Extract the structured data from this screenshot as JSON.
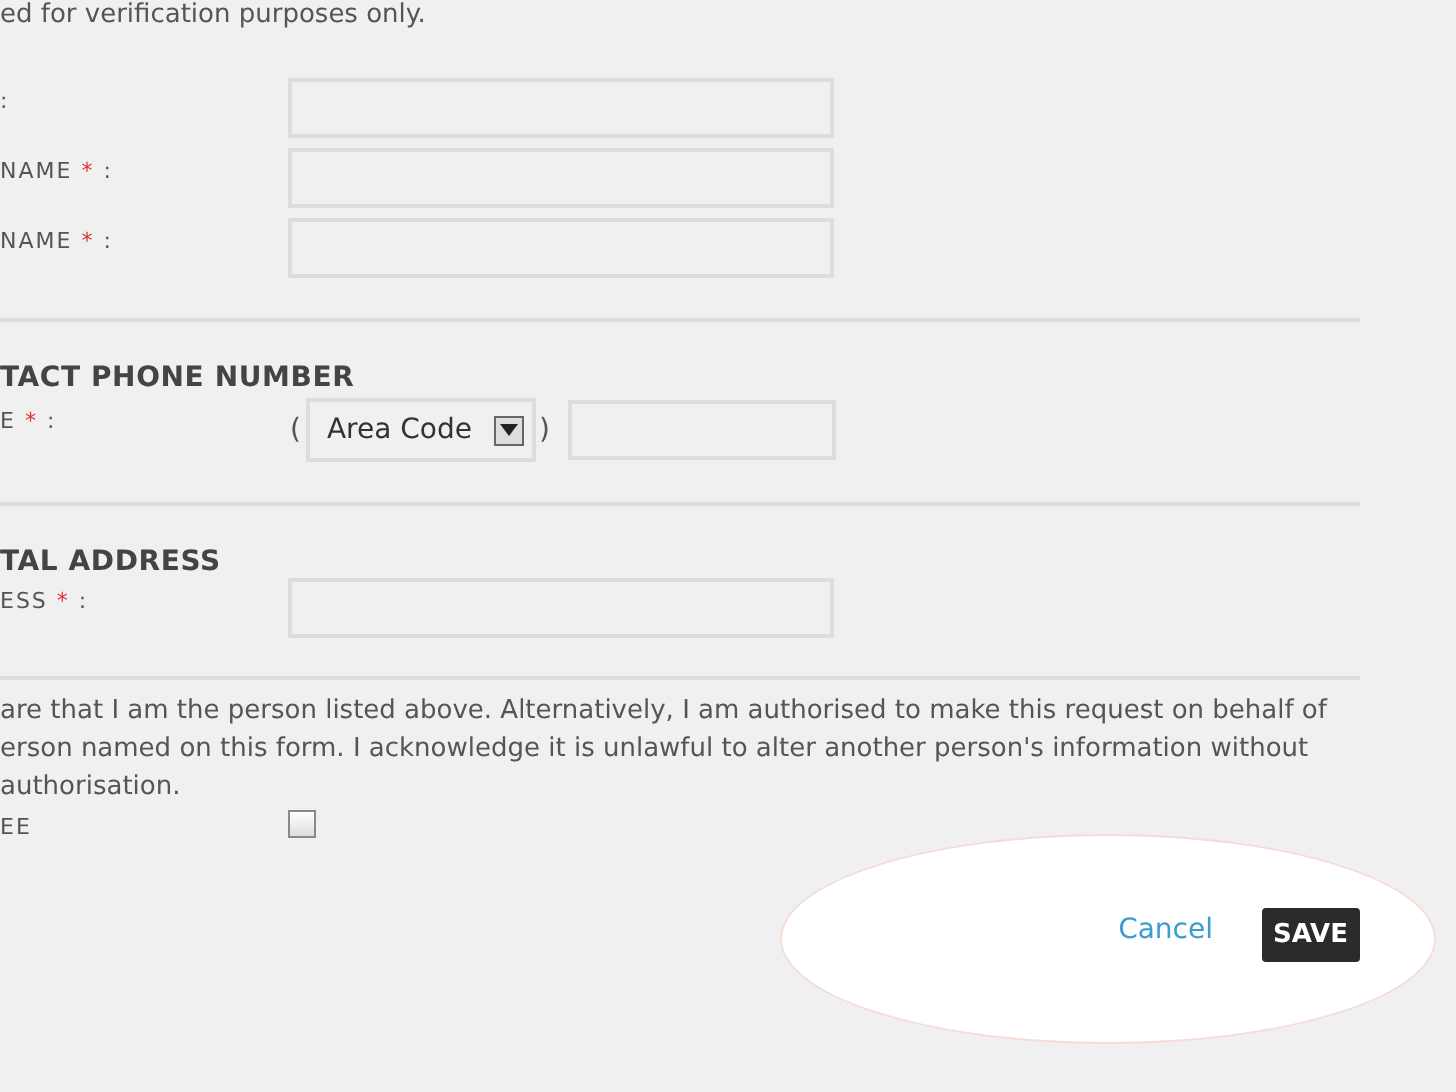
{
  "intro": "ed for verification purposes only.",
  "name_fields": [
    {
      "suffix": ":"
    },
    {
      "label": "NAME",
      "asterisk": "*",
      "suffix": ":"
    },
    {
      "label": "NAME",
      "asterisk": "*",
      "suffix": ":"
    }
  ],
  "phone_section": {
    "heading": "TACT PHONE NUMBER",
    "label": "E",
    "asterisk": "*",
    "suffix": ":",
    "open_paren": "(",
    "area_code": "Area Code",
    "close_paren": ")"
  },
  "address_section": {
    "heading": "TAL ADDRESS",
    "label": "ESS",
    "asterisk": "*",
    "suffix": ":"
  },
  "declaration": [
    "are that I am the person listed above. Alternatively, I am authorised to make this request on behalf of",
    "erson named on this form. I acknowledge it is unlawful to alter another person's information without",
    "authorisation."
  ],
  "agree": {
    "label": "EE",
    "checked": false
  },
  "buttons": {
    "cancel": "Cancel",
    "save": "SAVE"
  }
}
